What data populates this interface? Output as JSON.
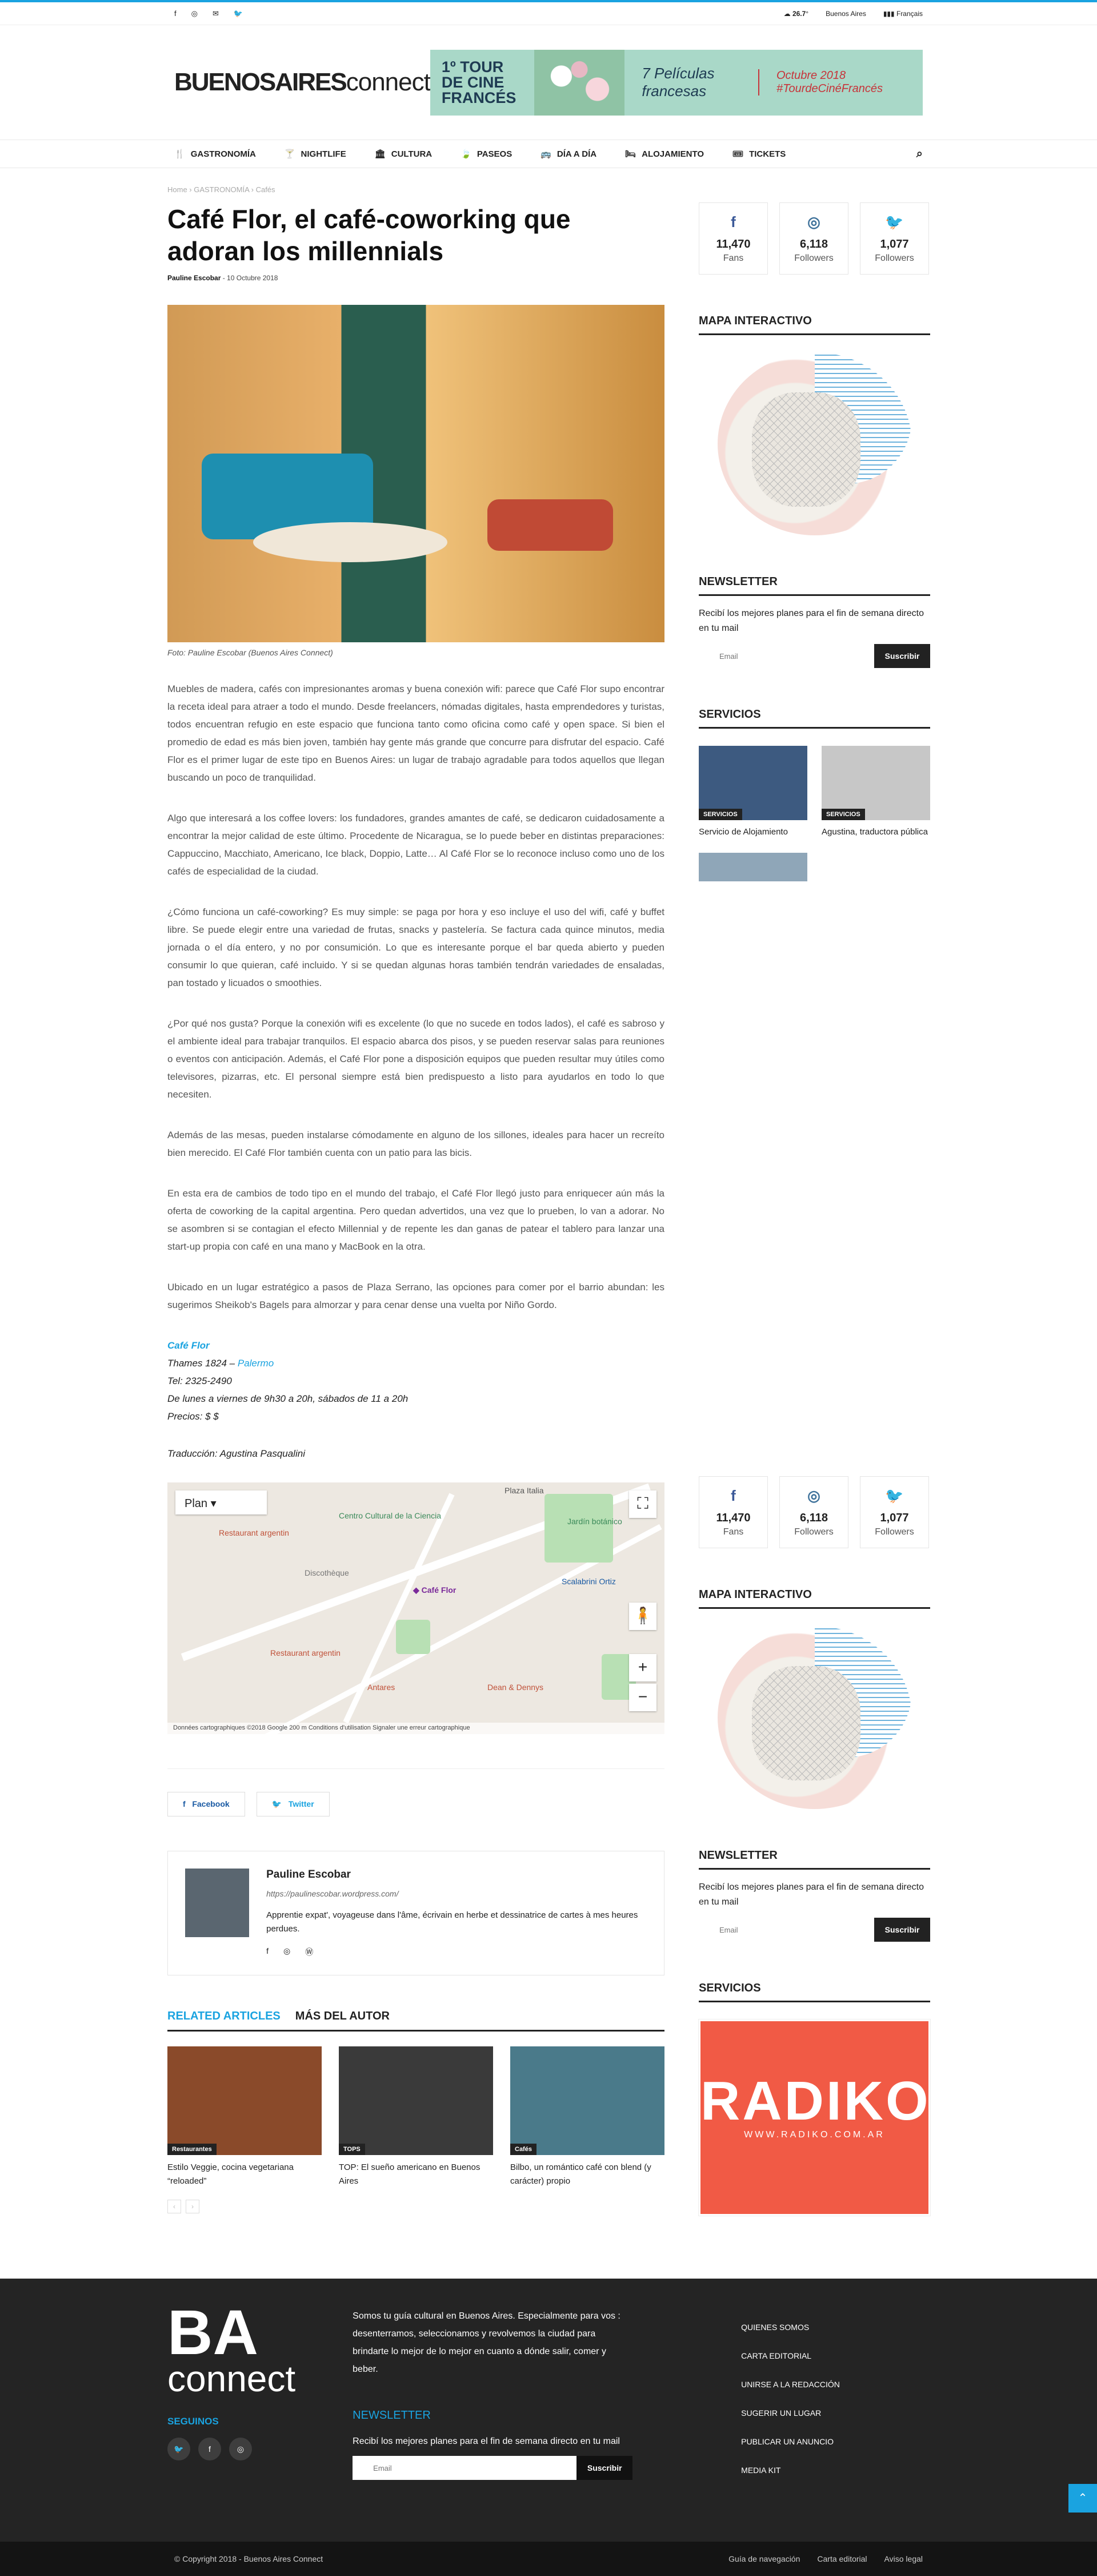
{
  "topbar": {
    "socials": [
      "f",
      "◎",
      "✉",
      "🐦"
    ],
    "weather": "26.7",
    "city": "Buenos Aires",
    "lang": "Français"
  },
  "header": {
    "logo_bold": "BUENOSAIRES",
    "logo_light": "connect",
    "banner": {
      "t1": "1º TOUR DE CINE FRANCÉS",
      "t2": "7 Películas francesas",
      "t3": "Octubre 2018 #TourdeCinéFrancés"
    }
  },
  "nav": [
    "GASTRONOMÍA",
    "NIGHTLIFE",
    "CULTURA",
    "PASEOS",
    "DÍA A DÍA",
    "ALOJAMIENTO",
    "TICKETS"
  ],
  "breadcrumb": "Home  ›  GASTRONOMÍA  ›  Cafés",
  "article": {
    "title": "Café Flor, el café-coworking que adoran los millennials",
    "author": "Pauline Escobar",
    "date": "- 10 Octubre 2018",
    "caption": "Foto: Pauline Escobar (Buenos Aires Connect)",
    "p1": "Muebles de madera, cafés con impresionantes aromas y buena conexión wifi: parece que Café Flor supo encontrar la receta ideal para atraer a todo el mundo. Desde freelancers, nómadas digitales, hasta emprendedores y turistas, todos encuentran refugio en este espacio que funciona tanto como oficina como café y open space. Si bien el promedio de edad es más bien joven, también hay gente más grande que concurre para disfrutar del espacio. Café Flor es el primer lugar de este tipo en Buenos Aires: un lugar de trabajo agradable para todos aquellos que llegan buscando un poco de tranquilidad.",
    "p2": "Algo que interesará a los coffee lovers: los fundadores, grandes amantes de café, se dedicaron cuidadosamente a encontrar la mejor calidad de este último. Procedente de Nicaragua, se lo puede beber en distintas preparaciones: Cappuccino, Macchiato, Americano, Ice black, Doppio, Latte… Al Café Flor se lo reconoce incluso como uno de los cafés de especialidad de la ciudad.",
    "p3": "¿Cómo funciona un café-coworking? Es muy simple: se paga por hora y eso incluye el uso del wifi, café y buffet libre. Se puede elegir entre una variedad de frutas, snacks y pastelería. Se factura cada quince minutos, media jornada o el día entero, y no por consumición. Lo que es interesante porque el bar queda abierto y pueden consumir lo que quieran, café incluido. Y si se quedan algunas horas también tendrán variedades de ensaladas, pan tostado y licuados o smoothies.",
    "p4": "¿Por qué nos gusta? Porque la conexión wifi es excelente (lo que no sucede en todos lados), el café es sabroso y el ambiente ideal para trabajar tranquilos. El espacio abarca dos pisos, y se pueden reservar salas para reuniones o eventos con anticipación. Además, el Café Flor pone a disposición equipos que pueden resultar muy útiles como televisores, pizarras, etc. El personal siempre está bien predispuesto a listo para ayudarlos en todo lo que necesiten.",
    "p5": "Además de las mesas, pueden instalarse cómodamente en alguno de los sillones, ideales para hacer un recreíto bien merecido. El Café Flor también cuenta con un patio para las bicis.",
    "p6": "En esta era de cambios de todo tipo en el mundo del trabajo, el Café Flor llegó justo para enriquecer aún más la oferta de coworking de la capital argentina. Pero quedan advertidos, una vez que lo prueben, lo van a adorar. No se asombren si se contagian el efecto Millennial y de repente les dan ganas de patear el tablero para lanzar una start-up propia con café en una mano y MacBook en la otra.",
    "p7": "Ubicado en un lugar estratégico a pasos de Plaza Serrano, las opciones para comer por el barrio abundan: les sugerimos Sheikob's Bagels para almorzar y para cenar dense una vuelta por Niño Gordo.",
    "info": {
      "name": "Café Flor",
      "address_pre": "Thames 1824 – ",
      "address_link": "Palermo",
      "tel": "Tel: 2325-2490",
      "hours": "De lunes a viernes de 9h30 a 20h, sábados de 11 a 20h",
      "price": "Precios: $ $"
    },
    "translation": "Traducción: Agustina Pasqualini",
    "map": {
      "mode": "Plan",
      "labels": [
        "Restaurant argentin",
        "Centro Cultural de la Ciencia",
        "Discothèque",
        "Café Flor",
        "Plaza Italia",
        "Jardín botánico",
        "Restaurant argentin",
        "Antares",
        "Dean & Dennys",
        "Scalabrini Ortiz"
      ],
      "footer": "Données cartographiques ©2018 Google   200 m   Conditions d'utilisation   Signaler une erreur cartographique"
    }
  },
  "share": {
    "facebook": "Facebook",
    "twitter": "Twitter"
  },
  "author_box": {
    "name": "Pauline Escobar",
    "url": "https://paulinescobar.wordpress.com/",
    "desc": "Apprentie expat', voyageuse dans l'âme, écrivain en herbe et dessinatrice de cartes à mes heures perdues."
  },
  "related": {
    "tab1": "RELATED ARTICLES",
    "tab2": "MÁS DEL AUTOR",
    "items": [
      {
        "cat": "Restaurantes",
        "title": "Estilo Veggie, cocina vegetariana “reloaded”",
        "color": "#8a4a2a"
      },
      {
        "cat": "TOPS",
        "title": "TOP: El sueño americano en Buenos Aires",
        "color": "#3a3a3a"
      },
      {
        "cat": "Cafés",
        "title": "Bilbo, un romántico café con blend (y carácter) propio",
        "color": "#4a7a8a"
      }
    ]
  },
  "sidebar": {
    "counters": [
      {
        "icon": "f",
        "value": "11,470",
        "label": "Fans",
        "color": "#3b5998"
      },
      {
        "icon": "◎",
        "value": "6,118",
        "label": "Followers",
        "color": "#3f729b"
      },
      {
        "icon": "🐦",
        "value": "1,077",
        "label": "Followers",
        "color": "#1aa3e0"
      }
    ],
    "map_title": "MAPA INTERACTIVO",
    "newsletter_title": "NEWSLETTER",
    "newsletter_text": "Recibí los mejores planes para el fin de semana directo en tu mail",
    "email_ph": "Email",
    "subscribe": "Suscribir",
    "services_title": "SERVICIOS",
    "services": [
      {
        "cat": "SERVICIOS",
        "title": "Servicio de Alojamiento",
        "color": "#3d5a80"
      },
      {
        "cat": "SERVICIOS",
        "title": "Agustina, traductora pública",
        "color": "#c7c7c7"
      }
    ],
    "radiko": "RADIKO",
    "radiko_url": "WWW.RADIKO.COM.AR"
  },
  "footer": {
    "logo_big": "BA",
    "logo_small": "connect",
    "seguinos": "SEGUINOS",
    "about": "Somos tu guía cultural en Buenos Aires. Especialmente para vos : desenterramos, seleccionamos y revolvemos la ciudad para brindarte lo mejor de lo mejor en cuanto a dónde salir, comer y beber.",
    "nl_title": "NEWSLETTER",
    "nl_text": "Recibí los mejores planes para el fin de semana directo en tu mail",
    "email_ph": "Email",
    "subscribe": "Suscribir",
    "links": [
      "QUIENES SOMOS",
      "CARTA EDITORIAL",
      "UNIRSE A LA REDACCIÓN",
      "SUGERIR UN LUGAR",
      "PUBLICAR UN ANUNCIO",
      "MEDIA KIT"
    ],
    "copyright": "© Copyright 2018 - Buenos Aires Connect",
    "bottom_links": [
      "Guía de navegación",
      "Carta editorial",
      "Aviso legal"
    ]
  }
}
